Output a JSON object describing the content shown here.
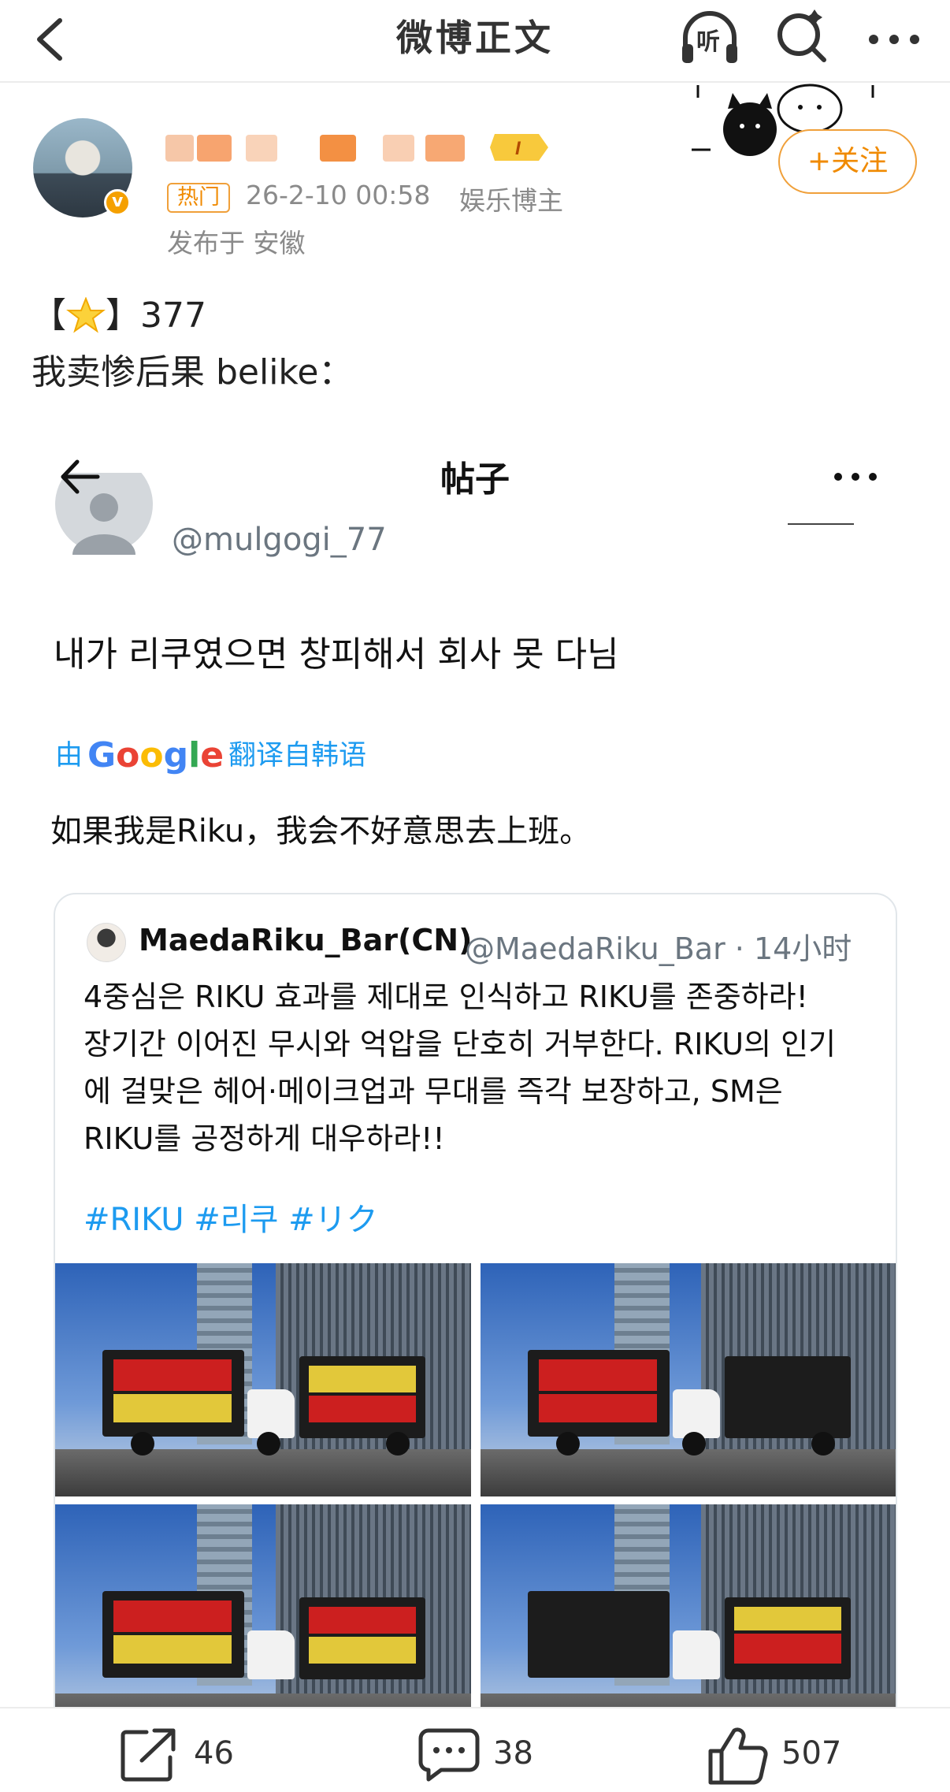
{
  "header": {
    "title": "微博正文",
    "listen_label": "听"
  },
  "author": {
    "hot_tag": "热门",
    "timestamp": "26-2-10 00:58",
    "role": "娱乐博主",
    "location": "发布于 安徽",
    "level_badge": "I",
    "follow_label": "+关注"
  },
  "post": {
    "line1_prefix": "【",
    "line1_suffix": "】377",
    "line2": "我卖惨后果 belike："
  },
  "embedded_post": {
    "nav_title": "帖子",
    "handle": "@mulgogi_77",
    "korean_text": "내가 리쿠였으면 창피해서 회사 못 다님",
    "translate_prefix": "由",
    "translate_brand": "Google",
    "translate_suffix": "翻译自韩语",
    "translation": "如果我是Riku，我会不好意思去上班。",
    "quote": {
      "name": "MaedaRiku_Bar(CN)",
      "handle_time": "@MaedaRiku_Bar · 14小时",
      "lines": [
        "4중심은 RIKU 효과를 제대로 인식하고 RIKU를 존중하라!",
        "장기간 이어진 무시와 억압을 단호히 거부한다. RIKU의 인기",
        "에 걸맞은 헤어·메이크업과 무대를 즉각 보장하고, SM은",
        "RIKU를 공정하게 대우하라!!"
      ],
      "hashtags": "#RIKU #리쿠 #リク"
    }
  },
  "actions": {
    "repost_count": "46",
    "comment_count": "38",
    "like_count": "507"
  },
  "colors": {
    "accent_orange": "#f08a00",
    "link_blue": "#1d9bf0",
    "meta_gray": "#8a8a8a"
  }
}
